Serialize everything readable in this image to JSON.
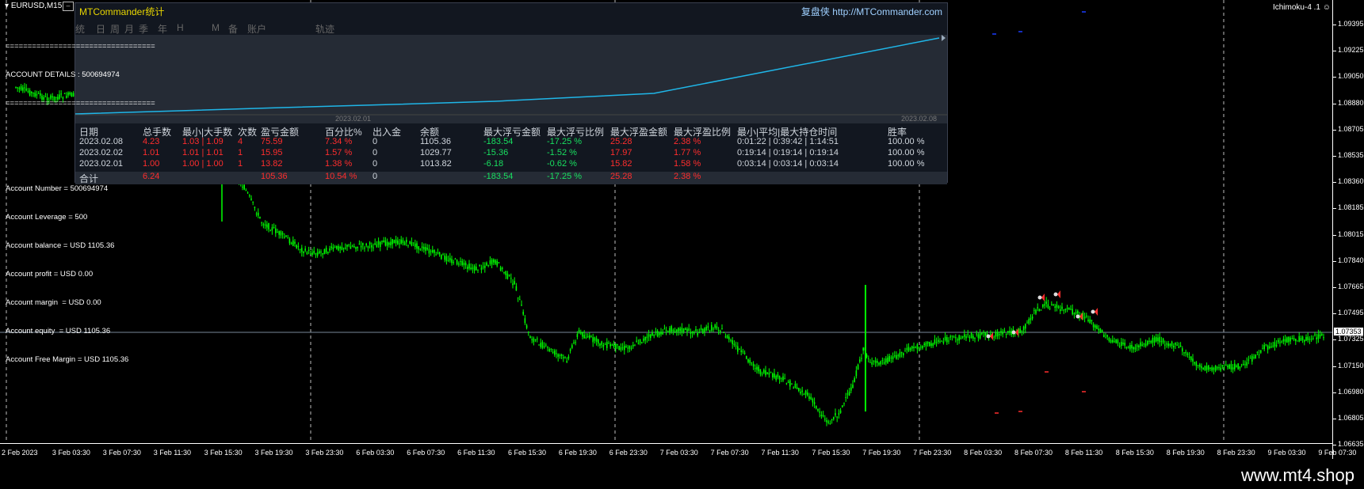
{
  "symbol": "EURUSD,M15",
  "indicator": "Ichimoku-4 .1",
  "watermark": "www.mt4.shop",
  "current_price": "1.07353",
  "panel": {
    "title": "MTCommander统计",
    "site_prefix": "复盘侠",
    "site": "http://MTCommander.com",
    "menu": [
      "统",
      "日",
      "周",
      "月",
      "季",
      "年",
      "H",
      "M",
      "备",
      "账户",
      "轨迹"
    ],
    "equity_date_left": "2023.02.01",
    "equity_date_right": "2023.02.08",
    "headers": [
      "日期",
      "总手数",
      "最小|大手数",
      "次数",
      "盈亏金额",
      "百分比%",
      "出入金",
      "余额",
      "最大浮亏金额",
      "最大浮亏比例",
      "最大浮盈金额",
      "最大浮盈比例",
      "最小|平均|最大持仓时间",
      "胜率"
    ],
    "rows": [
      [
        "2023.02.08",
        "4.23",
        "1.03 | 1.09",
        "4",
        "75.59",
        "7.34 %",
        "0",
        "1105.36",
        "-183.54",
        "-17.25 %",
        "25.28",
        "2.38 %",
        "0:01:22 | 0:39:42 | 1:14:51",
        "100.00 %"
      ],
      [
        "2023.02.02",
        "1.01",
        "1.01 | 1.01",
        "1",
        "15.95",
        "1.57 %",
        "0",
        "1029.77",
        "-15.36",
        "-1.52 %",
        "17.97",
        "1.77 %",
        "0:19:14 | 0:19:14 | 0:19:14",
        "100.00 %"
      ],
      [
        "2023.02.01",
        "1.00",
        "1.00 | 1.00",
        "1",
        "13.82",
        "1.38 %",
        "0",
        "1013.82",
        "-6.18",
        "-0.62 %",
        "15.82",
        "1.58 %",
        "0:03:14 | 0:03:14 | 0:03:14",
        "100.00 %"
      ]
    ],
    "total": [
      "合计",
      "6.24",
      "",
      "",
      "105.36",
      "10.54 %",
      "0",
      "",
      "-183.54",
      "-17.25 %",
      "25.28",
      "2.38 %",
      "",
      ""
    ]
  },
  "account": {
    "sep": "==================================",
    "details": "ACCOUNT DETAILS : 500694974",
    "lines": [
      "Account Number = 500694974",
      "Account Leverage = 500",
      "Account balance = USD 1105.36",
      "Account profit = USD 0.00",
      "Account margin  = USD 0.00",
      "Account equity  = USD 1105.36",
      "Account Free Margin = USD 1105.36"
    ]
  },
  "price_axis": [
    "1.09395",
    "1.09225",
    "1.09050",
    "1.08880",
    "1.08705",
    "1.08535",
    "1.08360",
    "1.08185",
    "1.08015",
    "1.07840",
    "1.07665",
    "1.07495",
    "1.07325",
    "1.07150",
    "1.06980",
    "1.06805",
    "1.06635"
  ],
  "time_axis": [
    "2 Feb 2023",
    "3 Feb 03:30",
    "3 Feb 07:30",
    "3 Feb 11:30",
    "3 Feb 15:30",
    "3 Feb 19:30",
    "3 Feb 23:30",
    "6 Feb 03:30",
    "6 Feb 07:30",
    "6 Feb 11:30",
    "6 Feb 15:30",
    "6 Feb 19:30",
    "6 Feb 23:30",
    "7 Feb 03:30",
    "7 Feb 07:30",
    "7 Feb 11:30",
    "7 Feb 15:30",
    "7 Feb 19:30",
    "7 Feb 23:30",
    "8 Feb 03:30",
    "8 Feb 07:30",
    "8 Feb 11:30",
    "8 Feb 15:30",
    "8 Feb 19:30",
    "8 Feb 23:30",
    "9 Feb 03:30",
    "9 Feb 07:30"
  ],
  "colors": {
    "candle": "#00ff00",
    "equity": "#1fb6e8",
    "profit": "#ff2d2d",
    "loss": "#18e060"
  }
}
